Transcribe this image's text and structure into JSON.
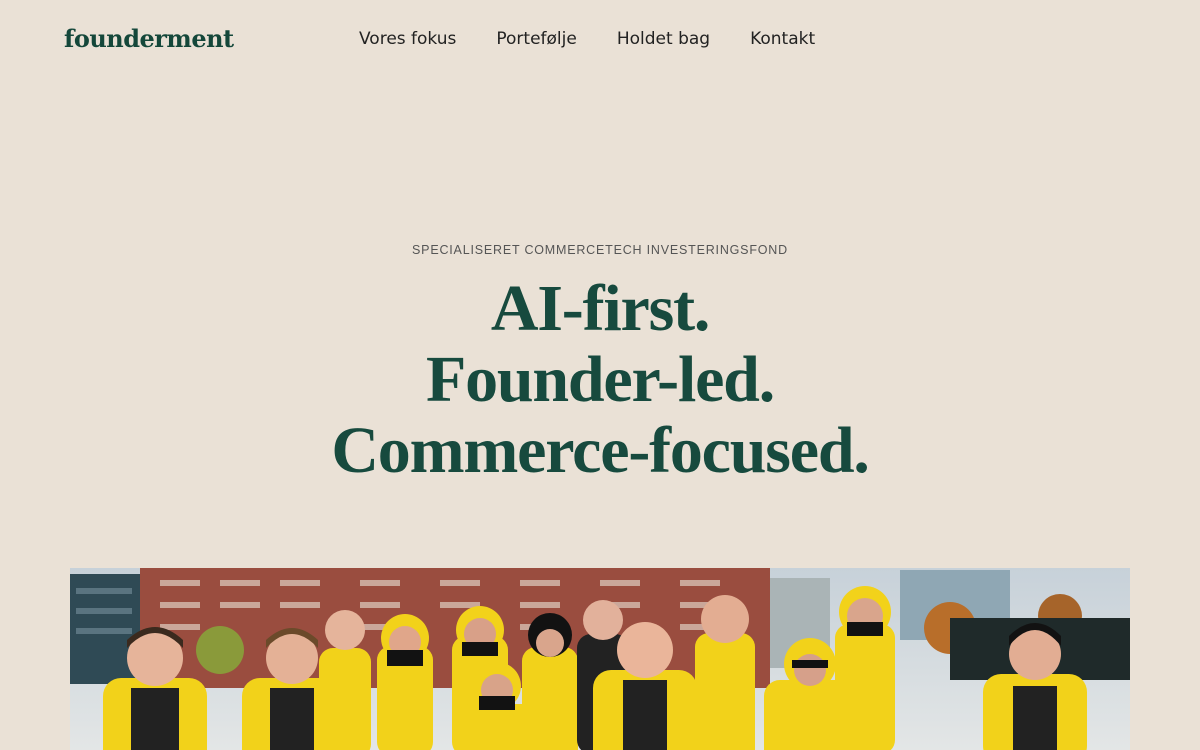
{
  "brand": {
    "logo": "founderment"
  },
  "nav": {
    "items": [
      {
        "label": "Vores fokus"
      },
      {
        "label": "Portefølje"
      },
      {
        "label": "Holdet bag"
      },
      {
        "label": "Kontakt"
      }
    ]
  },
  "hero": {
    "eyebrow": "SPECIALISERET COMMERCETECH INVESTERINGSFOND",
    "headline": [
      "AI-first.",
      "Founder-led.",
      "Commerce-focused."
    ]
  },
  "colors": {
    "background": "#EAE1D6",
    "brand_green": "#14473A",
    "jacket_yellow": "#F2D21A"
  }
}
